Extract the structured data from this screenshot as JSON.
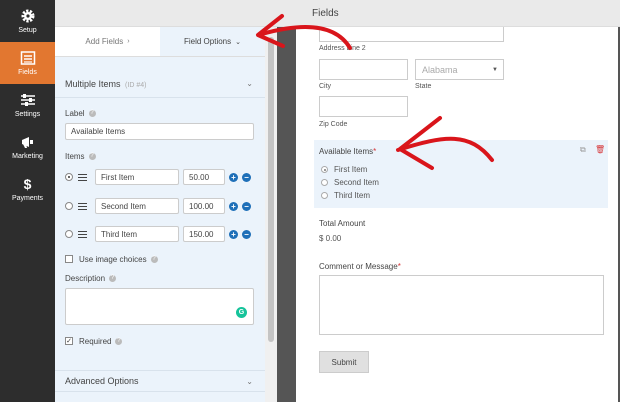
{
  "nav": {
    "items": [
      {
        "label": "Setup",
        "icon": "gear-icon"
      },
      {
        "label": "Fields",
        "icon": "fields-list-icon",
        "active": true
      },
      {
        "label": "Settings",
        "icon": "sliders-icon"
      },
      {
        "label": "Marketing",
        "icon": "megaphone-icon"
      },
      {
        "label": "Payments",
        "icon": "dollar-icon"
      }
    ]
  },
  "topbar": {
    "title": "Fields"
  },
  "panel": {
    "tabs": {
      "add_fields": "Add Fields",
      "add_fields_chevron": "›",
      "field_options": "Field Options",
      "field_options_chevron": "⌄"
    },
    "section_title": "Multiple Items",
    "section_id": "(ID #4)",
    "label_label": "Label",
    "label_value": "Available Items",
    "items_label": "Items",
    "items": [
      {
        "name": "First Item",
        "price": "50.00",
        "selected": true
      },
      {
        "name": "Second Item",
        "price": "100.00",
        "selected": false
      },
      {
        "name": "Third Item",
        "price": "150.00",
        "selected": false
      }
    ],
    "use_image_choices": "Use image choices",
    "description_label": "Description",
    "required_label": "Required",
    "required_checked": "✓",
    "advanced_options": "Advanced Options"
  },
  "preview": {
    "address_line2": "Address Line 2",
    "city_label": "City",
    "state_label": "State",
    "state_value": "Alabama",
    "zip_label": "Zip Code",
    "available_items_label": "Available Items",
    "required_mark": "*",
    "choices": [
      "First Item",
      "Second Item",
      "Third Item"
    ],
    "total_label": "Total Amount",
    "total_value": "$ 0.00",
    "comment_label": "Comment or Message",
    "submit_label": "Submit"
  },
  "colors": {
    "accent": "#e27730",
    "nav_bg": "#2d2d2d",
    "panel_bg": "#ebf3fb",
    "button_blue": "#1e6fb8",
    "arrow_red": "#d9151b"
  }
}
